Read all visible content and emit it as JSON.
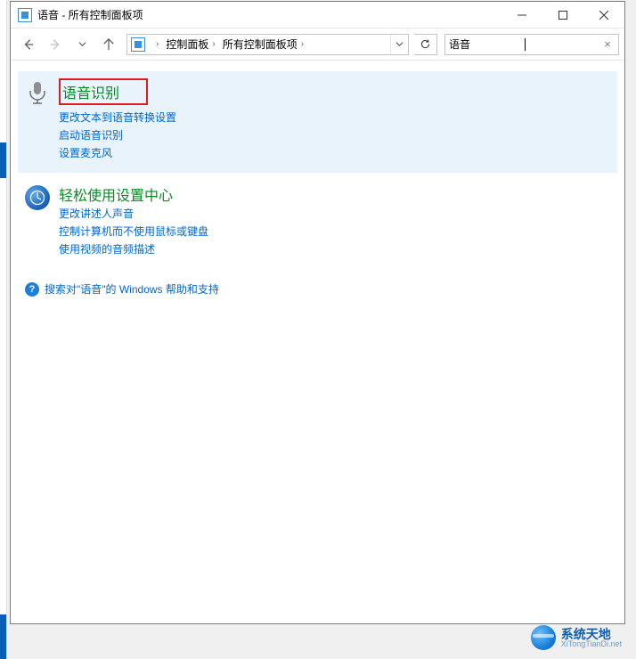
{
  "titlebar": {
    "title": "语音 - 所有控制面板项"
  },
  "breadcrumbs": {
    "item0": "控制面板",
    "item1": "所有控制面板项"
  },
  "search": {
    "value": "语音"
  },
  "results": {
    "group0": {
      "title": "语音识别",
      "links": {
        "l0": "更改文本到语音转换设置",
        "l1": "启动语音识别",
        "l2": "设置麦克风"
      }
    },
    "group1": {
      "title": "轻松使用设置中心",
      "links": {
        "l0": "更改讲述人声音",
        "l1": "控制计算机而不使用鼠标或键盘",
        "l2": "使用视频的音频描述"
      }
    }
  },
  "help": {
    "text": "搜索对\"语音\"的 Windows 帮助和支持"
  },
  "watermark": {
    "cn": "系统天地",
    "url": "XiTongTianDi.net"
  }
}
